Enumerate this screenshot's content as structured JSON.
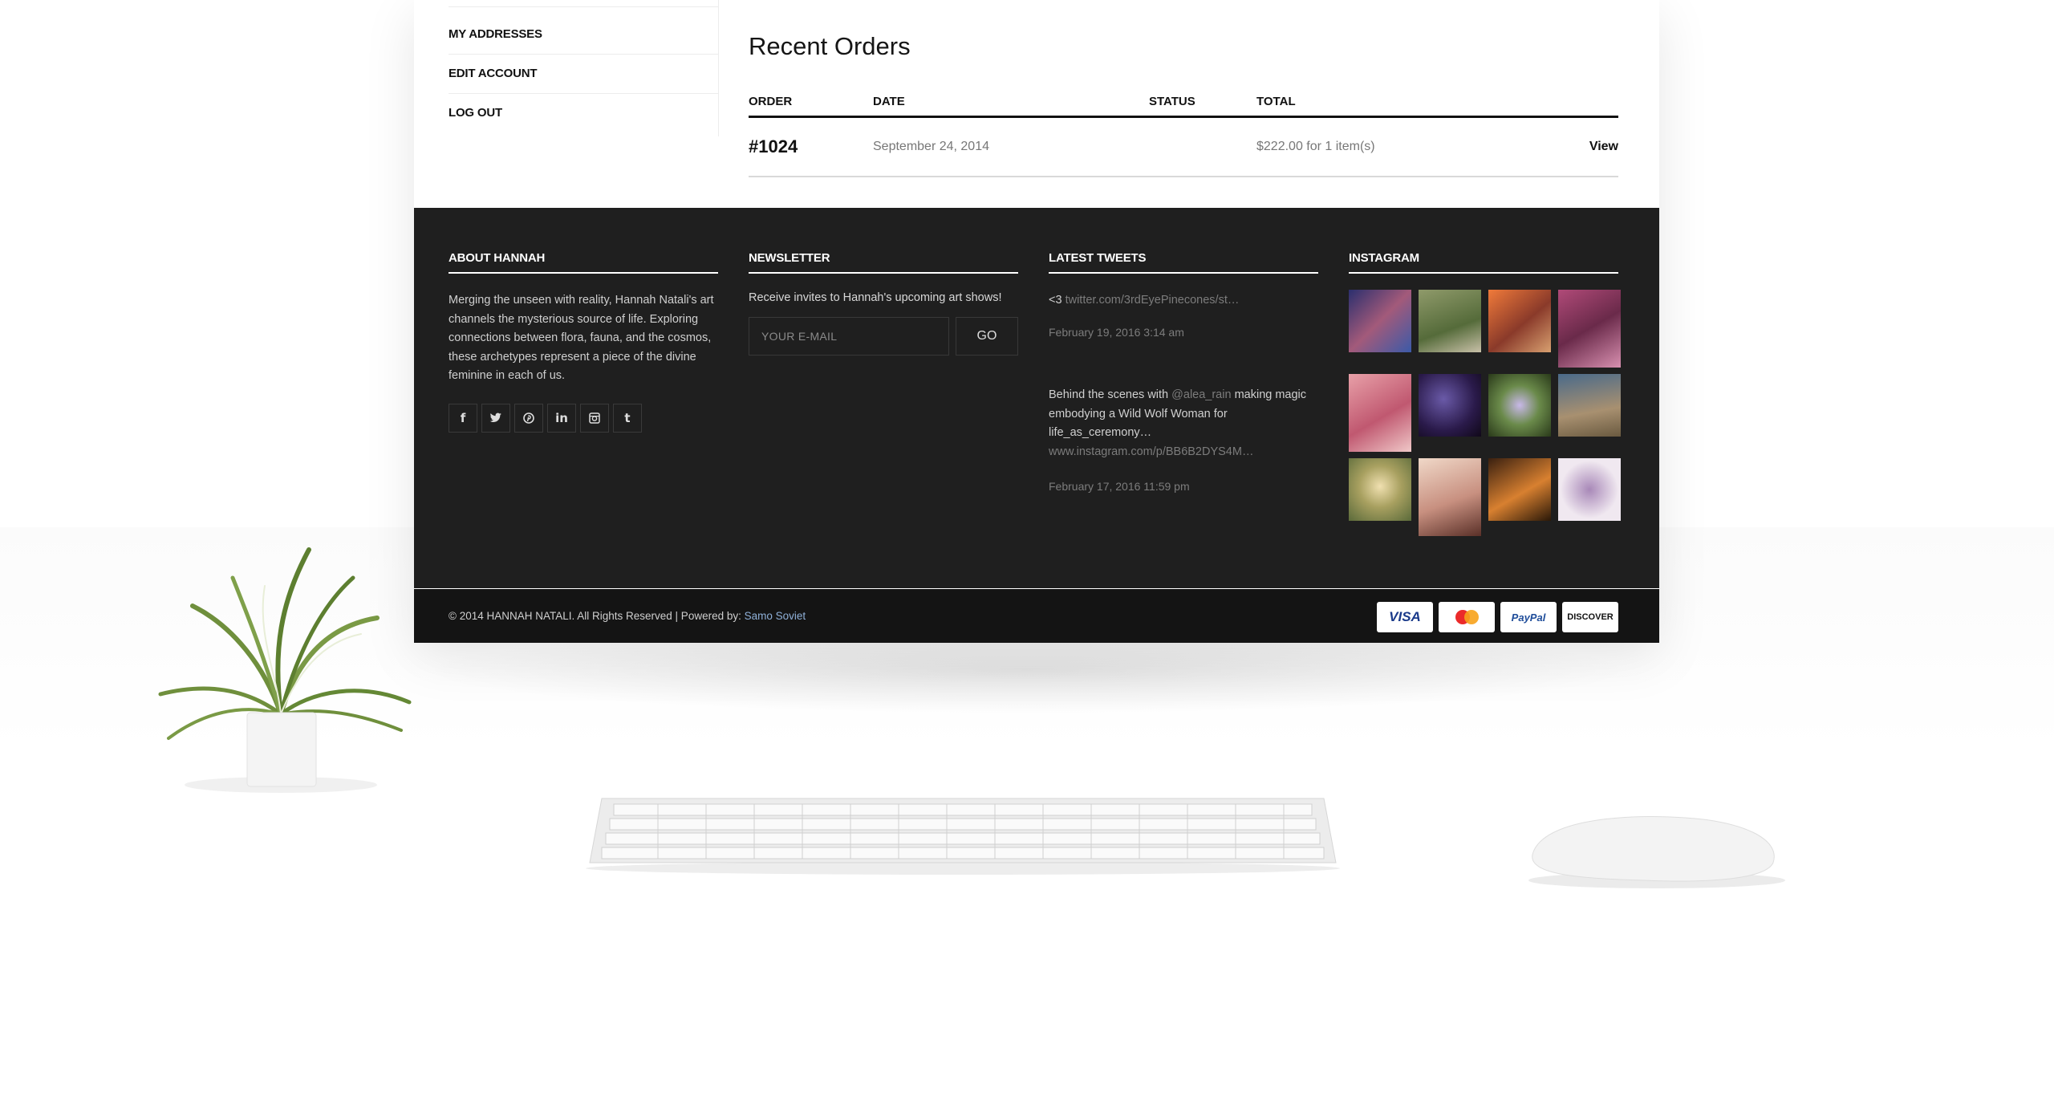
{
  "account_nav": {
    "items": [
      "MY ADDRESSES",
      "EDIT ACCOUNT",
      "LOG OUT"
    ]
  },
  "orders": {
    "title": "Recent Orders",
    "headers": [
      "ORDER",
      "DATE",
      "STATUS",
      "TOTAL"
    ],
    "rows": [
      {
        "order": "#1024",
        "date": "September 24, 2014",
        "status": "",
        "total": "$222.00 for 1 item(s)",
        "action": "View"
      }
    ]
  },
  "footer": {
    "about": {
      "title": "ABOUT HANNAH",
      "text": "Merging the unseen with reality, Hannah Natali's art channels the mysterious source of life. Exploring connections between flora, fauna, and the cosmos, these archetypes represent a piece of the divine feminine in each of us.",
      "socials": [
        "facebook-icon",
        "twitter-icon",
        "pinterest-icon",
        "linkedin-icon",
        "instagram-icon",
        "tumblr-icon"
      ]
    },
    "newsletter": {
      "title": "NEWSLETTER",
      "text": "Receive invites to Hannah's upcoming art shows!",
      "email_placeholder": "YOUR E-MAIL",
      "go_label": "GO"
    },
    "tweets": {
      "title": "LATEST TWEETS",
      "items": [
        {
          "prefix": "<3 ",
          "mention": "",
          "text": "",
          "link": "twitter.com/3rdEyePinecones/st…",
          "date": "February 19, 2016 3:14 am"
        },
        {
          "prefix": "Behind the scenes with ",
          "mention": "@alea_rain",
          "text": " making magic embodying a Wild Wolf Woman for life_as_ceremony…",
          "link": "www.instagram.com/p/BB6B2DYS4M…",
          "date": "February 17, 2016 11:59 pm"
        }
      ]
    },
    "instagram": {
      "title": "INSTAGRAM"
    },
    "copyright": "© 2014 HANNAH NATALI. All Rights Reserved | Powered by: ",
    "powered_by": "Samo Soviet",
    "payments": [
      "VISA",
      "MasterCard",
      "PayPal",
      "DISCOVER"
    ]
  },
  "colors": {
    "footer_bg": "#1f1f1f",
    "bottom_bar_bg": "#141414",
    "link_blue": "#8fb0d8"
  }
}
